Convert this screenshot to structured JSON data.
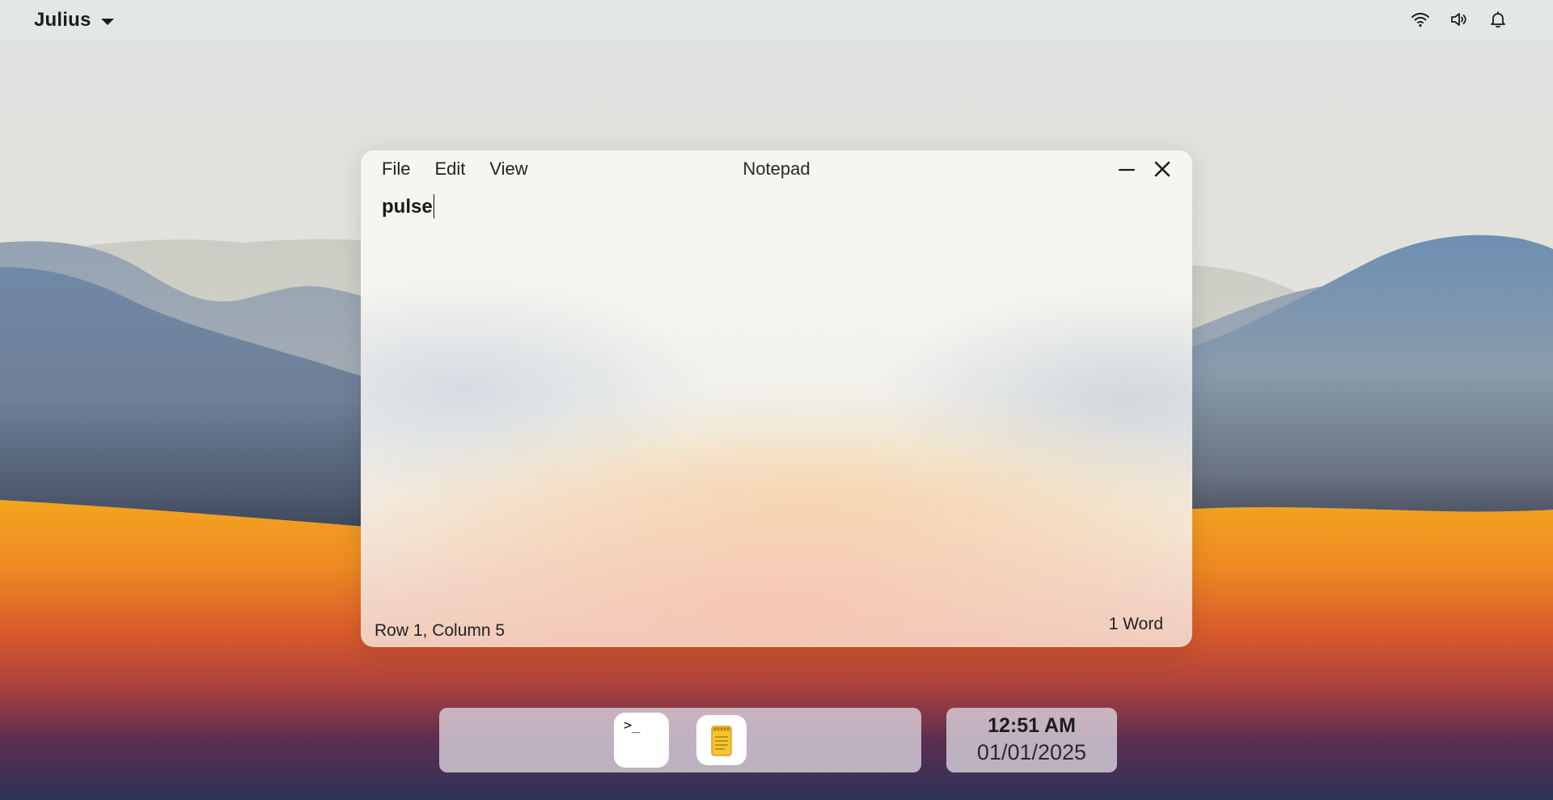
{
  "desktop": {
    "wallpaper_colors": {
      "sky_top": "#dfe3e3",
      "mountain_far": "#c9ccc6",
      "mountain_mid": "#8e9cac",
      "mountain_near": "#6f829c",
      "sand_orange": "#f0a020",
      "sand_red": "#d65a2c",
      "dusk_purple": "#4f2b52",
      "night_navy": "#2f3458"
    }
  },
  "topbar": {
    "user": "Julius",
    "user_menu_icon": "caret-down-icon",
    "tray_icons": [
      "wifi-icon",
      "volume-icon",
      "bell-icon"
    ]
  },
  "notepad": {
    "title": "Notepad",
    "menu": [
      "File",
      "Edit",
      "View"
    ],
    "content": "pulse",
    "status_position": "Row 1, Column 5",
    "status_word_count": "1 Word",
    "controls": [
      "minimize-icon",
      "close-icon"
    ]
  },
  "dock": {
    "apps": [
      {
        "name": "Terminal",
        "icon": "terminal-icon",
        "glyph": ">_"
      },
      {
        "name": "Notepad",
        "icon": "notepad-icon"
      }
    ]
  },
  "clock": {
    "time": "12:51 AM",
    "date": "01/01/2025"
  },
  "colors": {
    "notepad_icon": "#f5c531",
    "text": "#1d1d1d"
  }
}
